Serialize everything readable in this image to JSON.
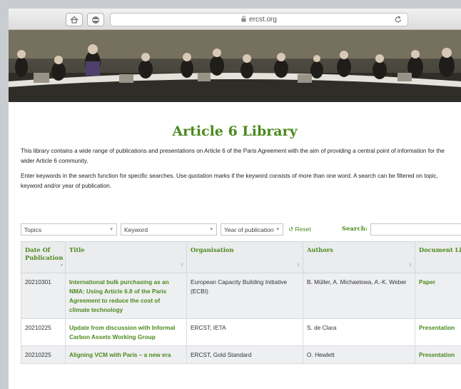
{
  "browser": {
    "url": "ercst.org"
  },
  "page": {
    "title": "Article 6 Library",
    "intro_1": "This library contains a wide range of publications and presentations on Article 6 of the Paris Agreement with the aim of providing a central point of information for the wider Article 6 community.",
    "intro_2": "Enter keywords in the search function for specific searches. Use quotation marks if the keyword consists of more than one word. A search can be filtered on topic, keyword and/or year of publication."
  },
  "filters": {
    "topics": "Topics",
    "keyword": "Keyword",
    "year": "Year of publication",
    "reset": "Reset",
    "search_label": "Search:"
  },
  "table": {
    "headers": [
      "Date Of Publication",
      "Title",
      "Organisation",
      "Authors",
      "Document Link"
    ],
    "rows": [
      {
        "date": "20210301",
        "title": "International bulk purchasing as an NMA: Using Article 6.8 of the Paris Agreement to reduce the cost of climate technology",
        "organisation": "European Capacity Building Initiative (ECBI)",
        "authors": "B. Müller, A. Michaelowa, A.-K. Weber",
        "link": "Paper"
      },
      {
        "date": "20210225",
        "title": "Update from discussion with Informal Carbon Assets Working Group",
        "organisation": "ERCST, IETA",
        "authors": "S. de Clara",
        "link": "Presentation"
      },
      {
        "date": "20210225",
        "title": "Aligning VCM with Paris – a new era",
        "organisation": "ERCST, Gold Standard",
        "authors": "O. Hewlett",
        "link": "Presentation"
      }
    ]
  },
  "colors": {
    "accent": "#4b8a1e",
    "header_bg": "#ebeced",
    "row_alt": "#eeeff1"
  }
}
